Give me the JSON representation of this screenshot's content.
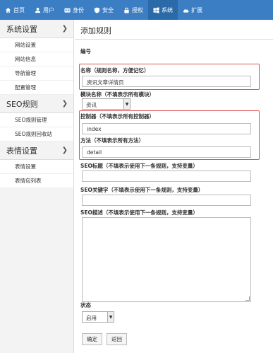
{
  "nav": {
    "items": [
      {
        "label": "首页",
        "icon": "home-icon"
      },
      {
        "label": "用户",
        "icon": "user-icon"
      },
      {
        "label": "身份",
        "icon": "id-icon"
      },
      {
        "label": "安全",
        "icon": "shield-icon"
      },
      {
        "label": "授权",
        "icon": "lock-icon"
      },
      {
        "label": "系统",
        "icon": "windows-icon"
      },
      {
        "label": "扩展",
        "icon": "cloud-icon"
      }
    ],
    "active": "系统",
    "bg_color": "#3c7ec4"
  },
  "sidebar": {
    "sections": [
      {
        "title": "系统设置",
        "items": [
          "网站设置",
          "网站信息",
          "导航管理",
          "配置管理"
        ]
      },
      {
        "title": "SEO规则",
        "items": [
          "SEO规则管理",
          "SEO规则回收站"
        ]
      },
      {
        "title": "表情设置",
        "items": [
          "表情设置",
          "表情包列表"
        ]
      }
    ]
  },
  "main": {
    "title": "添加规则",
    "form": {
      "id_label": "编号",
      "name_label": "名称（规则名称，方便记忆）",
      "name_value": "资讯文章详情页",
      "module_label": "模块名称（不填表示所有模块）",
      "module_value": "资讯",
      "controller_label": "控制器（不填表示所有控制器）",
      "controller_value": "index",
      "action_label": "方法（不填表示所有方法）",
      "action_value": "detail",
      "seo_title_label": "SEO标题（不填表示使用下一条规则，支持变量）",
      "seo_title_value": "",
      "seo_keywords_label": "SEO关键字（不填表示使用下一条规则，支持变量）",
      "seo_keywords_value": "",
      "seo_desc_label": "SEO描述（不填表示使用下一条规则，支持变量）",
      "status_label": "状态",
      "status_value": "启用",
      "submit_label": "确定",
      "back_label": "返回"
    }
  }
}
